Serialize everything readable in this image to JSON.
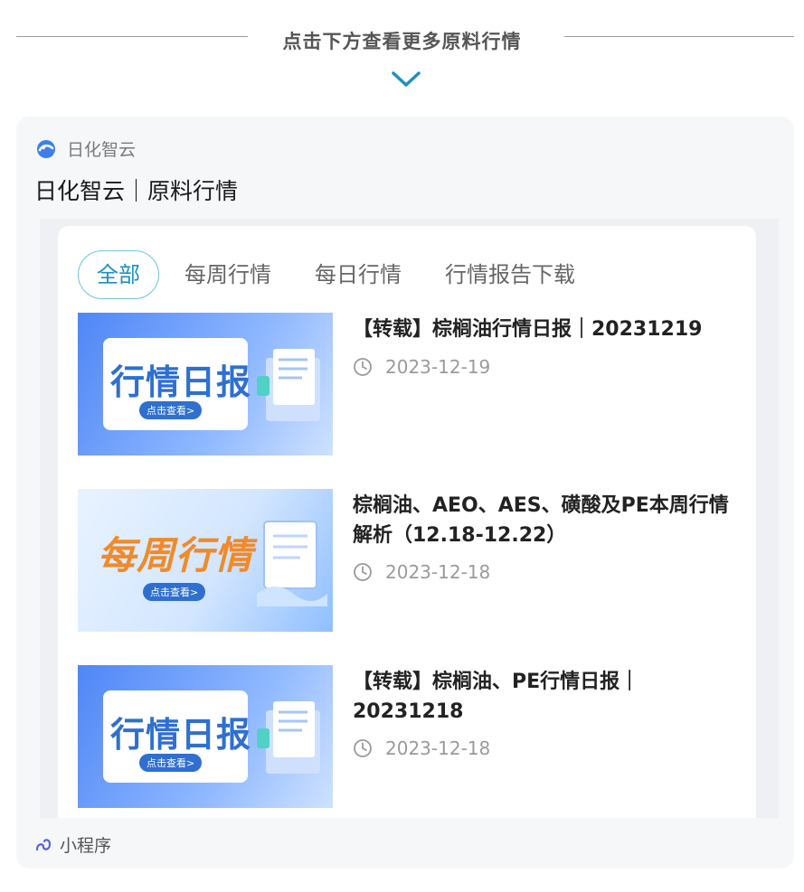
{
  "header": {
    "title": "点击下方查看更多原料行情"
  },
  "card": {
    "app_name": "日化智云",
    "title": "日化智云｜原料行情",
    "tabs": [
      "全部",
      "每周行情",
      "每日行情",
      "行情报告下载"
    ],
    "items": [
      {
        "thumb_text": "行情日报",
        "thumb_button": "点击查看>",
        "title": "【转载】棕榈油行情日报｜20231219",
        "date": "2023-12-19"
      },
      {
        "thumb_text": "每周行情",
        "thumb_button": "点击查看>",
        "title": "棕榈油、AEO、AES、磺酸及PE本周行情解析（12.18-12.22）",
        "date": "2023-12-18"
      },
      {
        "thumb_text": "行情日报",
        "thumb_button": "点击查看>",
        "title": "【转载】棕榈油、PE行情日报｜20231218",
        "date": "2023-12-18"
      }
    ],
    "footer_label": "小程序"
  },
  "colors": {
    "accent": "#1f8fc0",
    "chevron": "#1f8fc0",
    "tab_border": "#6cc6d6",
    "daily_thumb": "#4f86f7",
    "weekly_text": "#f08a2a"
  },
  "icons": {
    "chevron": "chevron-down-icon",
    "app_logo": "app-logo-icon",
    "clock": "clock-icon",
    "mini_program": "mini-program-link-icon"
  }
}
